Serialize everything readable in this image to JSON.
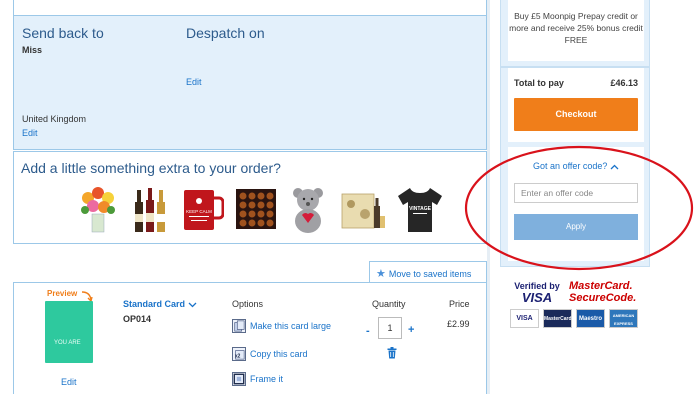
{
  "delivery": {
    "send_back_title": "Send back to",
    "send_back_name": "Miss",
    "send_back_country": "United Kingdom",
    "send_back_edit": "Edit",
    "despatch_title": "Despatch on",
    "despatch_edit": "Edit"
  },
  "extras": {
    "title": "Add a little something extra to your order?",
    "items": [
      {
        "icon": "flowers-icon"
      },
      {
        "icon": "wine-bottles-icon"
      },
      {
        "icon": "mug-icon"
      },
      {
        "icon": "chocolates-icon"
      },
      {
        "icon": "teddy-bear-icon"
      },
      {
        "icon": "gift-hamper-icon"
      },
      {
        "icon": "t-shirt-icon"
      }
    ],
    "mug_text": "KEEP CALM",
    "tshirt_text": "VINTAGE"
  },
  "saved": {
    "label": "Move to saved items"
  },
  "card": {
    "preview_label": "Preview",
    "thumb_text": "YOU ARE",
    "edit_label": "Edit",
    "name": "Standard Card",
    "code": "OP014",
    "options_head": "Options",
    "options": [
      "Make this card large",
      "Copy this card",
      "Frame it"
    ],
    "quantity_head": "Quantity",
    "quantity": "1",
    "minus": "-",
    "plus": "+",
    "price_head": "Price",
    "price": "£2.99"
  },
  "sidebar": {
    "promo_text": "Buy £5 Moonpig Prepay credit or more and receive 25% bonus credit FREE",
    "total_label": "Total to pay",
    "total_value": "£46.13",
    "checkout_label": "Checkout",
    "offer_link": "Got an offer code?",
    "offer_placeholder": "Enter an offer code",
    "apply_label": "Apply",
    "verified_by": "Verified by",
    "visa": "VISA",
    "mastercard_line1": "MasterCard.",
    "mastercard_line2": "SecureCode.",
    "payment_logos": [
      "VISA",
      "MasterCard",
      "Maestro",
      "AMERICAN EXPRESS"
    ]
  },
  "colors": {
    "accent": "#1a73c9",
    "checkout": "#f07e1a",
    "panel": "#e3f0fb",
    "annotation": "#d9121b"
  }
}
